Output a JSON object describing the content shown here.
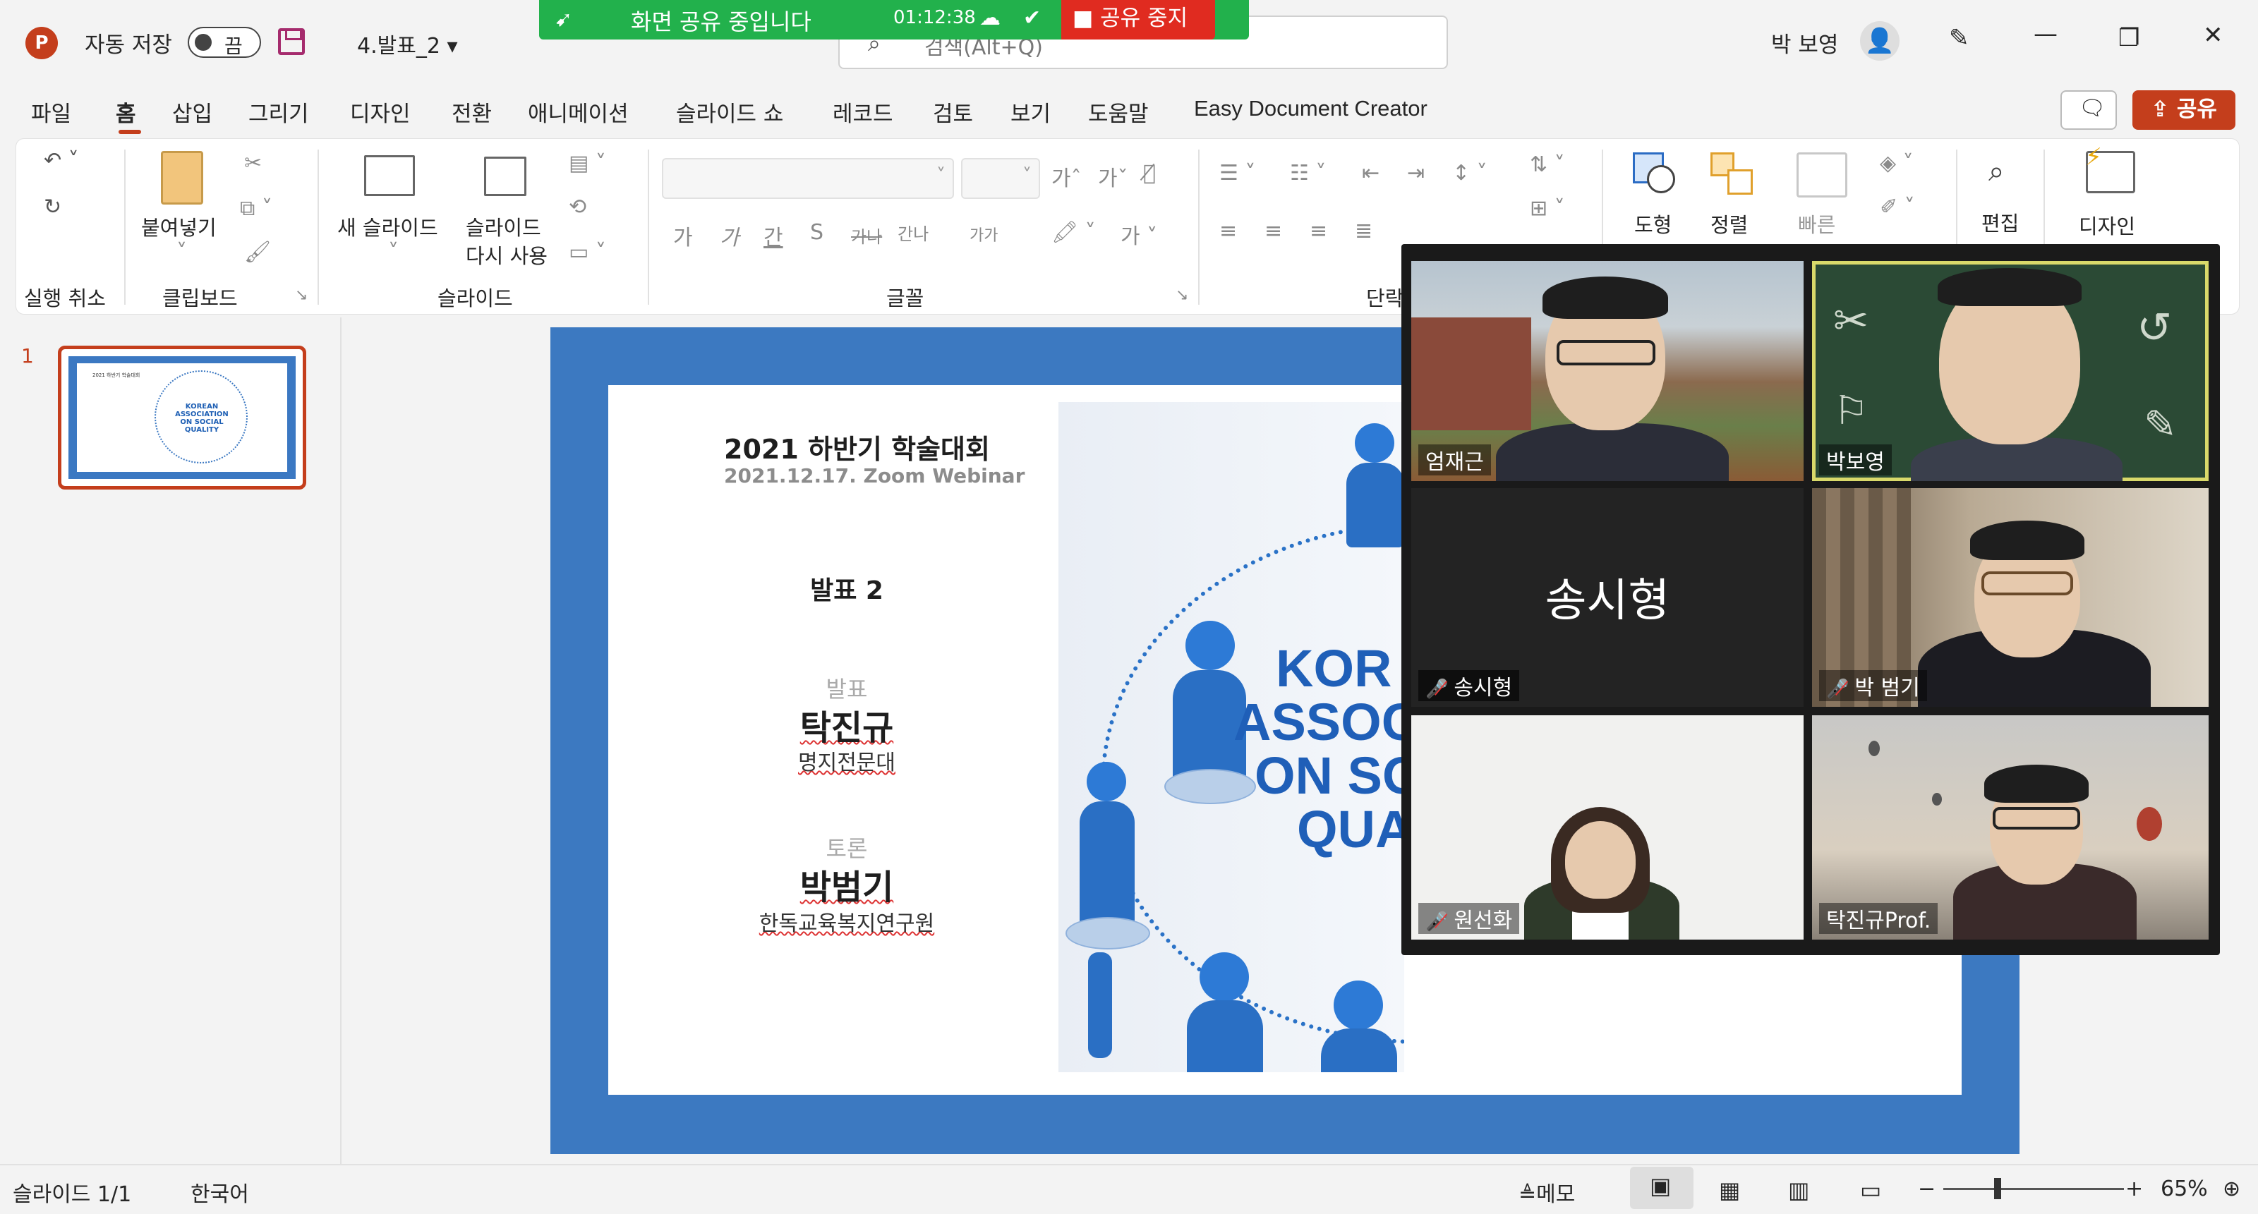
{
  "app": {
    "autosave_label": "자동 저장",
    "autosave_state": "끔",
    "filename": "4.발표_2",
    "search_placeholder": "검색(Alt+Q)",
    "user_name": "박 보영"
  },
  "screen_share": {
    "status": "화면 공유 중입니다",
    "timer": "01:12:38",
    "stop_label": "공유 중지"
  },
  "menu_tabs": [
    "파일",
    "홈",
    "삽입",
    "그리기",
    "디자인",
    "전환",
    "애니메이션",
    "슬라이드 쇼",
    "레코드",
    "검토",
    "보기",
    "도움말",
    "Easy Document Creator"
  ],
  "share_button": "공유",
  "ribbon": {
    "undo_group": "실행 취소",
    "paste": "붙여넣기",
    "clipboard_group": "클립보드",
    "new_slide": "새 슬라이드",
    "reuse_slide_1": "슬라이드",
    "reuse_slide_2": "다시 사용",
    "slides_group": "슬라이드",
    "font_group": "글꼴",
    "paragraph_group": "단락",
    "shapes": "도형",
    "arrange": "정렬",
    "quick_styles": "빠른",
    "editing": "편집",
    "designer": "디자인",
    "font_buttons": [
      "가",
      "가",
      "간",
      "S",
      "가나",
      "간나",
      "가가"
    ]
  },
  "thumbnail": {
    "number": "1",
    "title": "2021 하반기 학술대회",
    "logo_lines": [
      "KOREAN",
      "ASSOCIATION",
      "ON SOCIAL",
      "QUALITY"
    ]
  },
  "slide": {
    "title": "2021 하반기 학술대회",
    "subtitle": "2021.12.17. Zoom Webinar",
    "session": "발표 2",
    "presenter_role": "발표",
    "presenter_name": "탁진규",
    "presenter_affil": "명지전문대",
    "discussant_role": "토론",
    "discussant_name": "박범기",
    "discussant_affil": "한독교육복지연구원",
    "logo_lines": [
      "KOR",
      "ASSOC",
      "ON SO",
      "QUA"
    ]
  },
  "zoom_participants": [
    {
      "name": "엄재근",
      "muted": false,
      "video": true
    },
    {
      "name": "박보영",
      "muted": false,
      "video": true,
      "active_speaker": true
    },
    {
      "name": "송시형",
      "muted": true,
      "video": false
    },
    {
      "name": "박 범기",
      "muted": true,
      "video": true
    },
    {
      "name": "원선화",
      "muted": true,
      "video": true
    },
    {
      "name": "탁진규Prof.",
      "muted": false,
      "video": true
    }
  ],
  "statusbar": {
    "slide_count": "슬라이드 1/1",
    "language": "한국어",
    "notes": "메모",
    "zoom_level": "65%"
  }
}
